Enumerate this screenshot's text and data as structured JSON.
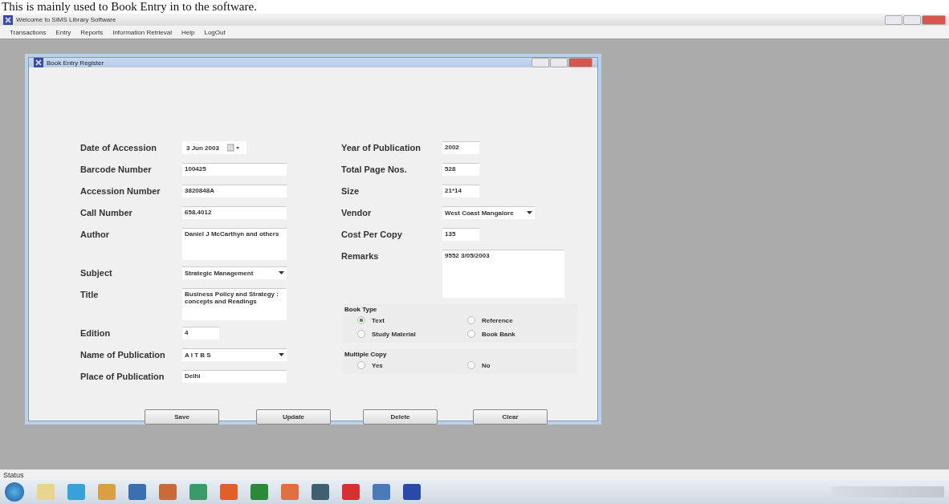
{
  "caption": "This is mainly used to Book Entry in to the software.",
  "app": {
    "title": "Welcome to SIMS Library Software",
    "menu": [
      "Transactions",
      "Entry",
      "Reports",
      "Information Retrieval",
      "Help",
      "LogOut"
    ]
  },
  "dialog": {
    "title": "Book Entry Register",
    "left_fields": [
      {
        "label": "Date of Accession",
        "value": "3 Jun 2003",
        "kind": "date"
      },
      {
        "label": "Barcode Number",
        "value": "100425",
        "kind": "text"
      },
      {
        "label": "Accession Number",
        "value": "3820848A",
        "kind": "text"
      },
      {
        "label": "Call Number",
        "value": "658.4012",
        "kind": "text"
      },
      {
        "label": "Author",
        "value": "Daniel J McCarthyn and others",
        "kind": "multiline"
      },
      {
        "label": "Subject",
        "value": "Strategic Management",
        "kind": "combo"
      },
      {
        "label": "Title",
        "value": "Business Policy and Strategy : concepts and Readings",
        "kind": "multiline"
      },
      {
        "label": "Edition",
        "value": "4",
        "kind": "short"
      },
      {
        "label": "Name of Publication",
        "value": "A I T B S",
        "kind": "combo"
      },
      {
        "label": "Place of Publication",
        "value": "Delhi",
        "kind": "text"
      }
    ],
    "right_fields": [
      {
        "label": "Year of Publication",
        "value": "2002",
        "kind": "short"
      },
      {
        "label": "Total Page Nos.",
        "value": "528",
        "kind": "short"
      },
      {
        "label": "Size",
        "value": "21*14",
        "kind": "short"
      },
      {
        "label": "Vendor",
        "value": "West Coast Mangalore",
        "kind": "combo"
      },
      {
        "label": "Cost Per Copy",
        "value": "135",
        "kind": "short"
      },
      {
        "label": "Remarks",
        "value": "9552 3/05/2003",
        "kind": "multiline"
      }
    ],
    "book_type": {
      "label": "Book Type",
      "options": [
        {
          "label": "Text",
          "selected": true
        },
        {
          "label": "Reference",
          "selected": false
        },
        {
          "label": "Study Material",
          "selected": false
        },
        {
          "label": "Book Bank",
          "selected": false
        }
      ]
    },
    "multiple_copy": {
      "label": "Multiple Copy",
      "options": [
        {
          "label": "Yes",
          "selected": false
        },
        {
          "label": "No",
          "selected": false
        }
      ]
    },
    "buttons": [
      "Save",
      "Update",
      "Delete",
      "Clear"
    ]
  },
  "status_bar": "Status"
}
